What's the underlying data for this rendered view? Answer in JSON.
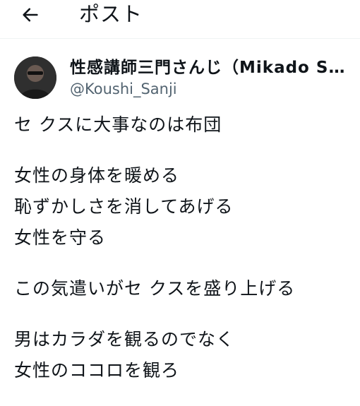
{
  "header": {
    "title": "ポスト",
    "back_icon": "arrow-left-icon"
  },
  "author": {
    "display_name": "性感講師三門さんじ（Mikado San...",
    "handle": "@Koushi_Sanji",
    "avatar_icon": "user-avatar"
  },
  "tweet": {
    "paragraphs": [
      [
        "セ クスに大事なのは布団"
      ],
      [
        "女性の身体を暖める",
        "恥ずかしさを消してあげる",
        "女性を守る"
      ],
      [
        "この気遣いがセ クスを盛り上げる"
      ],
      [
        "男はカラダを観るのでなく",
        "女性のココロを観ろ"
      ]
    ]
  }
}
